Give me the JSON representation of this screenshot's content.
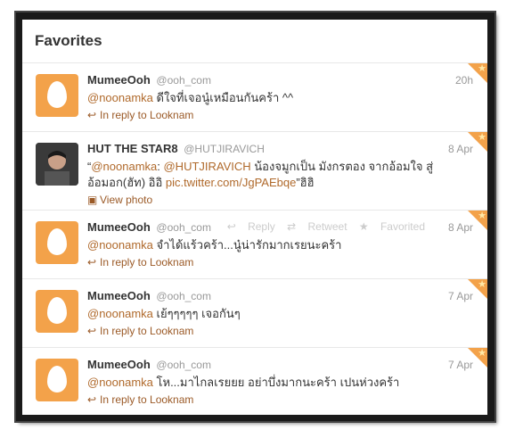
{
  "header": {
    "title": "Favorites"
  },
  "tweets": [
    {
      "name": "MumeeOoh",
      "handle": "@ooh_com",
      "time": "20h",
      "mention": "@noonamka",
      "text": " ดีใจที่เจอนู๋เหมือนกันคร้า ^^",
      "context": "In reply to Looknam"
    },
    {
      "name": "HUT THE STAR8",
      "handle": "@HUTJIRAVICH",
      "time": "8 Apr",
      "text_prefix": "“",
      "mention": "@noonamka",
      "text_mid": ": ",
      "mention2": "@HUTJIRAVICH",
      "text": " น้องจมูกเป็น มังกรตอง จากอ้อมใจ สู่อ้อมอก(ฮัท) อิอิ ",
      "link": "pic.twitter.com/JgPAEbqe",
      "text_suffix": "”ฮิฮิ",
      "context": "View photo"
    },
    {
      "name": "MumeeOoh",
      "handle": "@ooh_com",
      "time": "8 Apr",
      "mention": "@noonamka",
      "text": " จำได้แร้วคร้า...นู๋น่ารักมากเรยนะคร้า",
      "context": "In reply to Looknam",
      "actions": {
        "reply": "Reply",
        "retweet": "Retweet",
        "favorited": "Favorited"
      }
    },
    {
      "name": "MumeeOoh",
      "handle": "@ooh_com",
      "time": "7 Apr",
      "mention": "@noonamka",
      "text": " เย้ๆๆๆๆๆ เจอกันๆ",
      "context": "In reply to Looknam"
    },
    {
      "name": "MumeeOoh",
      "handle": "@ooh_com",
      "time": "7 Apr",
      "mention": "@noonamka",
      "text": " โห...มาไกลเรยยย อย่าบึ่งมากนะคร้า เปนห่วงคร้า",
      "context": "In reply to Looknam"
    }
  ],
  "icons": {
    "reply": "reply-arrow-icon",
    "photo": "photo-icon",
    "star": "star-icon",
    "retweet": "retweet-icon"
  },
  "colors": {
    "accent": "#f3a24a",
    "link": "#b06a2c",
    "context": "#9b5a27",
    "frame": "#1a1a1a"
  }
}
